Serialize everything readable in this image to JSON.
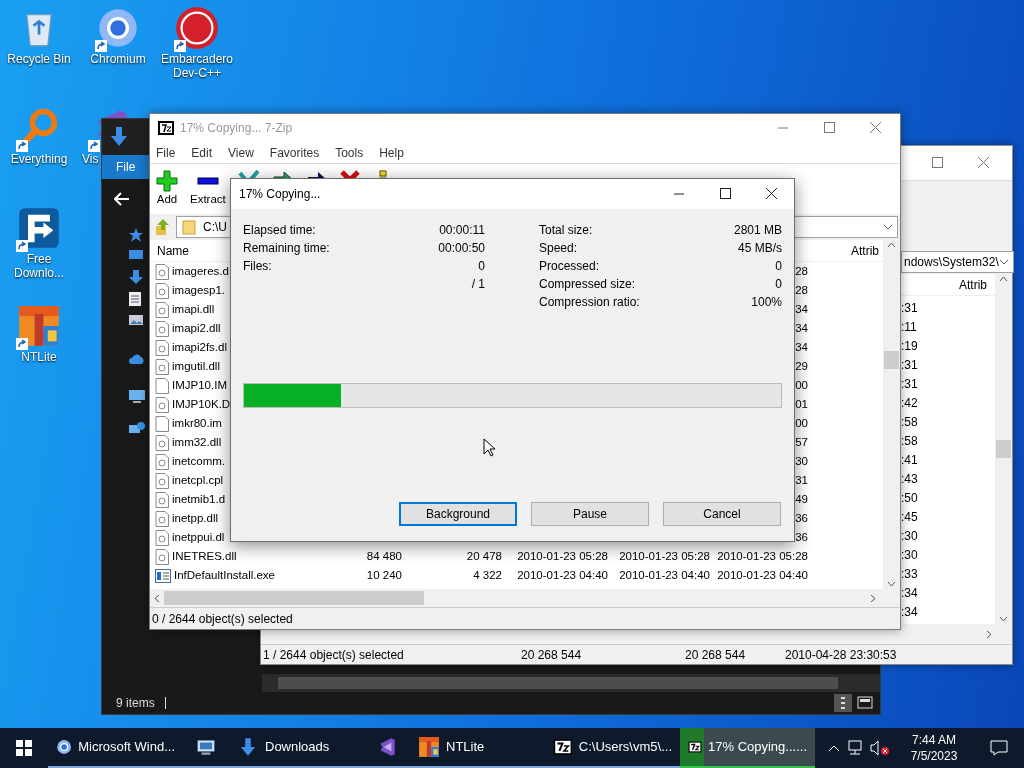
{
  "desktop_icons": [
    {
      "label": "Recycle Bin",
      "kind": "recycle",
      "shortcut": false
    },
    {
      "label": "Chromium",
      "kind": "chromium",
      "shortcut": true
    },
    {
      "label": "Embarcadero Dev-C++",
      "kind": "devcpp",
      "shortcut": true
    },
    {
      "label": "Everything",
      "kind": "everything",
      "shortcut": true
    },
    {
      "label": "Vis",
      "kind": "vs",
      "shortcut": true
    },
    {
      "label": "Free Downlo...",
      "kind": "fdm",
      "shortcut": true
    },
    {
      "label": "NTLite",
      "kind": "ntlite",
      "shortcut": true
    }
  ],
  "explorer": {
    "tab": "File",
    "status": "9 items"
  },
  "back_window": {
    "path": "ndows\\System32\\",
    "column": "Attrib",
    "rows": [
      ":31",
      ":11",
      ":19",
      ":31",
      ":31",
      ":42",
      ":58",
      ":58",
      ":41",
      ":43",
      ":50",
      ":45",
      ":30",
      ":30",
      ":33",
      ":34",
      ":34"
    ],
    "status": [
      "1 / 2644 object(s) selected",
      "20 268 544",
      "20 268 544",
      "2010-04-28 23:30:53"
    ]
  },
  "main_window": {
    "title": "17% Copying... 7-Zip",
    "menu": [
      "File",
      "Edit",
      "View",
      "Favorites",
      "Tools",
      "Help"
    ],
    "toolbar": [
      {
        "label": "Add",
        "kind": "add"
      },
      {
        "label": "Extract",
        "kind": "extract"
      },
      {
        "kind": "test"
      },
      {
        "kind": "copy"
      },
      {
        "kind": "move"
      },
      {
        "kind": "delete"
      },
      {
        "kind": "info"
      }
    ],
    "path": "C:\\U",
    "columns": [
      "Name",
      "Attrib"
    ],
    "rows": [
      {
        "name": "imageres.d",
        "kind": "dll",
        "cells": [
          "28"
        ]
      },
      {
        "name": "imagesp1.",
        "kind": "dll",
        "cells": [
          "28"
        ]
      },
      {
        "name": "imapi.dll",
        "kind": "dll",
        "cells": [
          "34"
        ]
      },
      {
        "name": "imapi2.dll",
        "kind": "dll",
        "cells": [
          "34"
        ]
      },
      {
        "name": "imapi2fs.dl",
        "kind": "dll",
        "cells": [
          "34"
        ]
      },
      {
        "name": "imgutil.dll",
        "kind": "dll",
        "cells": [
          "29"
        ]
      },
      {
        "name": "IMJP10.IM",
        "kind": "blank",
        "cells": [
          "00"
        ]
      },
      {
        "name": "IMJP10K.D",
        "kind": "dll",
        "cells": [
          "01"
        ]
      },
      {
        "name": "imkr80.im",
        "kind": "blank",
        "cells": [
          "00"
        ]
      },
      {
        "name": "imm32.dll",
        "kind": "dll",
        "cells": [
          "57"
        ]
      },
      {
        "name": "inetcomm.",
        "kind": "dll",
        "cells": [
          "30"
        ]
      },
      {
        "name": "inetcpl.cpl",
        "kind": "dll",
        "cells": [
          "31"
        ]
      },
      {
        "name": "inetmib1.d",
        "kind": "dll",
        "cells": [
          "49"
        ]
      },
      {
        "name": "inetpp.dll",
        "kind": "dll",
        "cells": [
          "36"
        ]
      },
      {
        "name": "inetppui.dl",
        "kind": "dll",
        "cells": [
          "36"
        ]
      },
      {
        "name": "INETRES.dll",
        "kind": "dll",
        "cells": [
          "84 480",
          "20 478",
          "2010-01-23 05:28",
          "2010-01-23 05:28",
          "2010-01-23 05:28"
        ]
      },
      {
        "name": "InfDefaultInstall.exe",
        "kind": "exe",
        "cells": [
          "10 240",
          "4 322",
          "2010-01-23 04:40",
          "2010-01-23 04:40",
          "2010-01-23 04:40"
        ]
      }
    ],
    "status": "0 / 2644 object(s) selected"
  },
  "dialog": {
    "title": "17% Copying...",
    "left": [
      {
        "label": "Elapsed time:",
        "value": "00:00:11"
      },
      {
        "label": "Remaining time:",
        "value": "00:00:50"
      },
      {
        "label": "Files:",
        "value": "0"
      },
      {
        "value": "/ 1"
      }
    ],
    "right": [
      {
        "label": "Total size:",
        "value": "2801 MB"
      },
      {
        "label": "Speed:",
        "value": "45 MB/s"
      },
      {
        "label": "Processed:",
        "value": "0"
      },
      {
        "label": "Compressed size:",
        "value": "0"
      },
      {
        "label": "Compression ratio:",
        "value": "100%"
      }
    ],
    "progress": {
      "level": 0.18
    },
    "buttons": [
      {
        "label": "Background",
        "focused": true
      },
      {
        "label": "Pause",
        "focused": false
      },
      {
        "label": "Cancel",
        "focused": false
      }
    ]
  },
  "taskbar": {
    "items": [
      {
        "label": "Microsoft Wind...",
        "kind": "chromium",
        "selected": false
      },
      {
        "kind": "cpl",
        "selected": false
      },
      {
        "label": "Downloads",
        "kind": "downloads",
        "selected": false
      },
      {
        "kind": "vs",
        "selected": false
      },
      {
        "label": "NTLite",
        "kind": "ntlite",
        "selected": false
      },
      {
        "label": "C:\\Users\\vm5\\...",
        "kind": "sevenzip",
        "selected": false
      },
      {
        "label": "17% Copying......",
        "kind": "sevenzip",
        "selected": true
      }
    ],
    "time": "7:44 AM",
    "date": "7/5/2023"
  }
}
